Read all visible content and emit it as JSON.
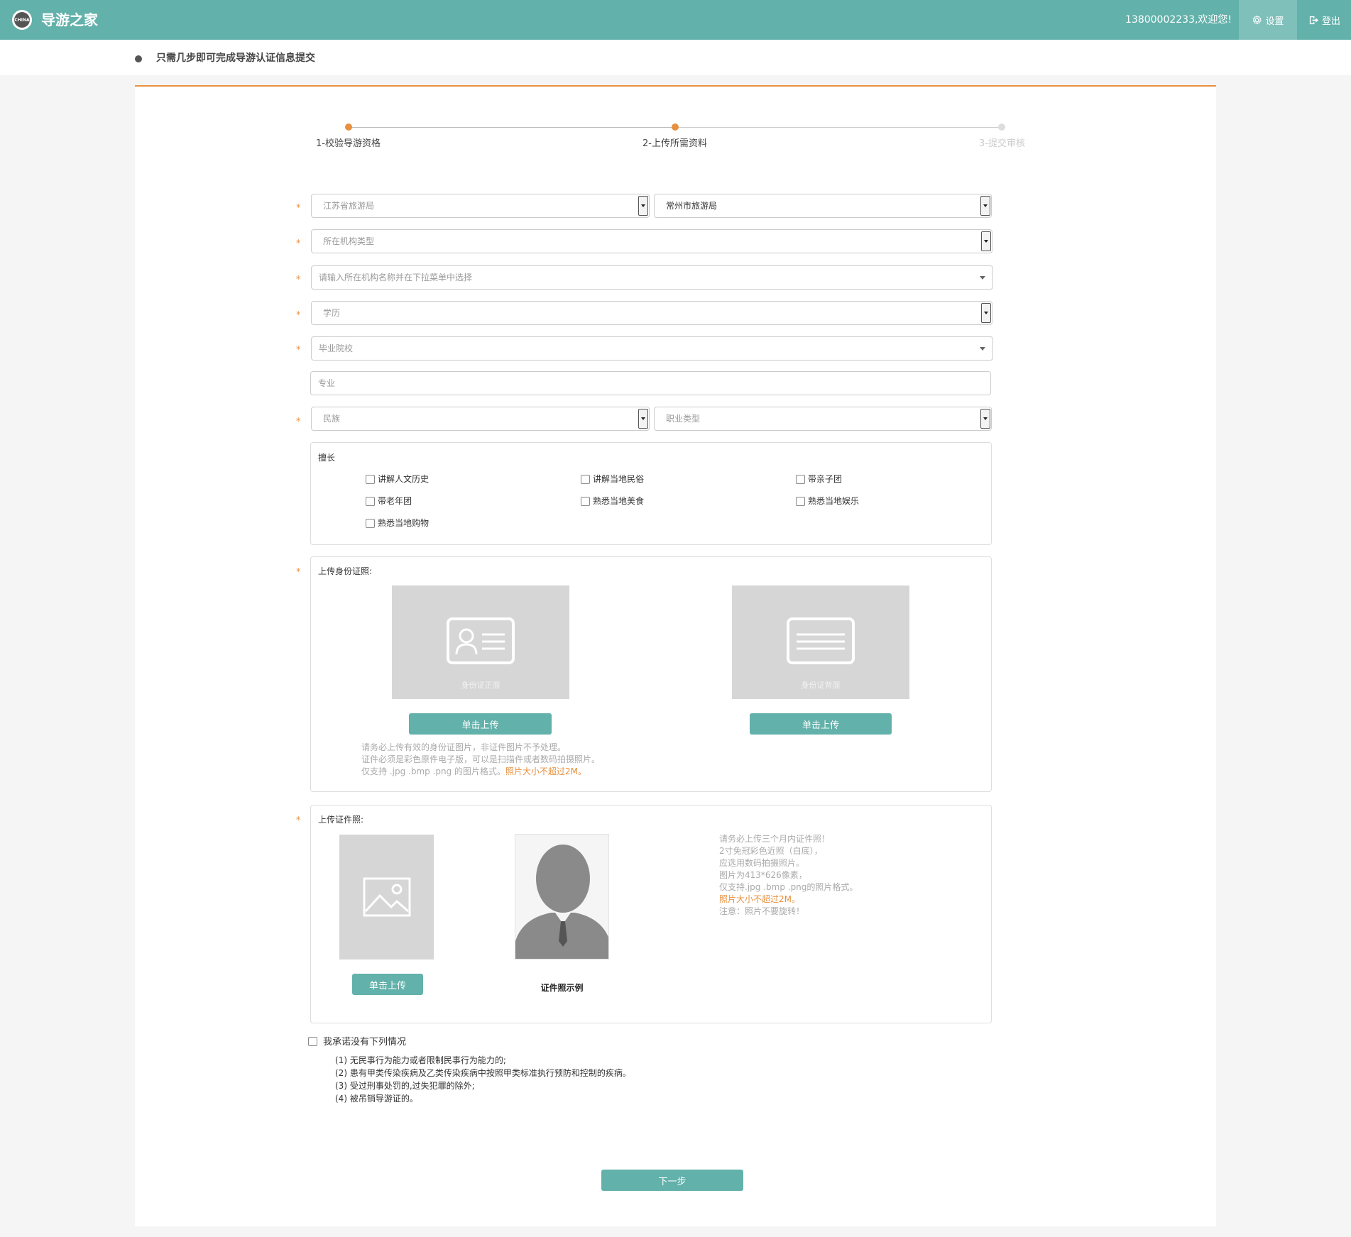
{
  "header": {
    "logo_text": "CHINA",
    "app_title": "导游之家",
    "welcome": "13800002233,欢迎您!",
    "settings_label": "设置",
    "logout_label": "登出",
    "accent_color": "#62b1aa"
  },
  "notice": {
    "text": "只需几步即可完成导游认证信息提交"
  },
  "steps": [
    {
      "label": "1-校验导游资格",
      "status": "done"
    },
    {
      "label": "2-上传所需资料",
      "status": "done"
    },
    {
      "label": "3-提交审核",
      "status": "todo"
    }
  ],
  "form": {
    "required_mark": "*",
    "province_bureau": {
      "placeholder": "江苏省旅游局"
    },
    "city_bureau": {
      "value": "常州市旅游局"
    },
    "org_type": {
      "placeholder": "所在机构类型"
    },
    "org_name": {
      "placeholder": "请输入所在机构名称并在下拉菜单中选择"
    },
    "education": {
      "placeholder": "学历"
    },
    "school": {
      "placeholder": "毕业院校"
    },
    "major": {
      "placeholder": "专业"
    },
    "ethnicity": {
      "placeholder": "民族"
    },
    "job_type": {
      "placeholder": "职业类型"
    }
  },
  "specialties": {
    "title": "擅长",
    "items": [
      "讲解人文历史",
      "讲解当地民俗",
      "带亲子团",
      "带老年团",
      "熟悉当地美食",
      "熟悉当地娱乐",
      "熟悉当地购物"
    ]
  },
  "id_upload": {
    "title": "上传身份证照:",
    "front_caption": "身份证正面",
    "back_caption": "身份证背面",
    "upload_label": "单击上传",
    "hint_line1": "请务必上传有效的身份证图片，非证件图片不予处理。",
    "hint_line2": "证件必须是彩色原件电子版，可以是扫描件或者数码拍摄照片。",
    "hint_line3": "仅支持 .jpg .bmp .png 的图片格式。",
    "hint_highlight": "照片大小不超过2M。"
  },
  "photo_upload": {
    "title": "上传证件照:",
    "upload_label": "单击上传",
    "sample_caption": "证件照示例",
    "hints": [
      "请务必上传三个月内证件照！",
      "2寸免冠彩色近照（白底），",
      "应选用数码拍摄照片。",
      "图片为413*626像素，",
      "仅支持.jpg .bmp .png的照片格式。"
    ],
    "hint_highlight": "照片大小不超过2M。",
    "hint_last": "注意：照片不要旋转！"
  },
  "pledge": {
    "title": "我承诺没有下列情况",
    "items": [
      "(1) 无民事行为能力或者限制民事行为能力的;",
      "(2) 患有甲类传染疾病及乙类传染疾病中按照甲类标准执行预防和控制的疾病。",
      "(3) 受过刑事处罚的,过失犯罪的除外;",
      "(4) 被吊销导游证的。"
    ]
  },
  "next_label": "下一步"
}
